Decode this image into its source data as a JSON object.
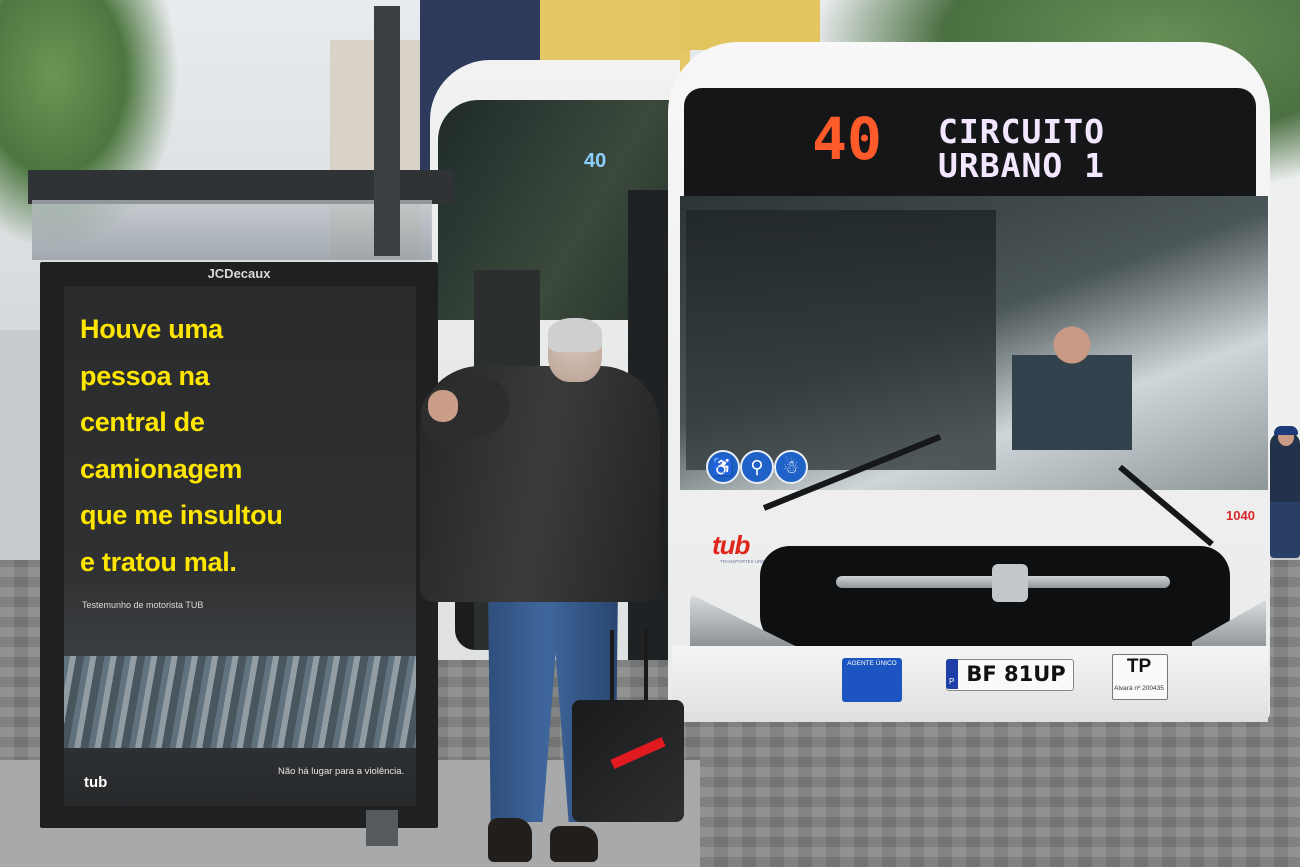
{
  "scene": {
    "description_labels": []
  },
  "ad_panel": {
    "brand": "JCDecaux",
    "headline_lines": [
      "Houve uma",
      "pessoa na",
      "central de",
      "camionagem",
      "que me insultou",
      "e tratou mal."
    ],
    "caption": "Testemunho de motorista TUB",
    "logo": "tub",
    "slogan": "Não há lugar para a violência.",
    "headline_color": "#ffe600"
  },
  "bus": {
    "route_number": "40",
    "destination_line1": "CIRCUITO",
    "destination_line2": "URBANO 1",
    "side_route": "40",
    "fleet_number": "1040",
    "logo": "tub",
    "logo_subtitle": "TRANSPORTES URBANOS DE BRAGA",
    "license_plate": "BF 81UP",
    "plate_country": "P",
    "tp_label": "TP",
    "tp_small": "Alvará nº 200435",
    "agent_badge": "AGENTE ÚNICO",
    "accessibility_icons": [
      "wheelchair-icon",
      "stroller-icon",
      "person-icon"
    ],
    "route_color": "#ff5a2a",
    "brand_blue": "#1b4aa6",
    "brand_red": "#e1251b"
  }
}
